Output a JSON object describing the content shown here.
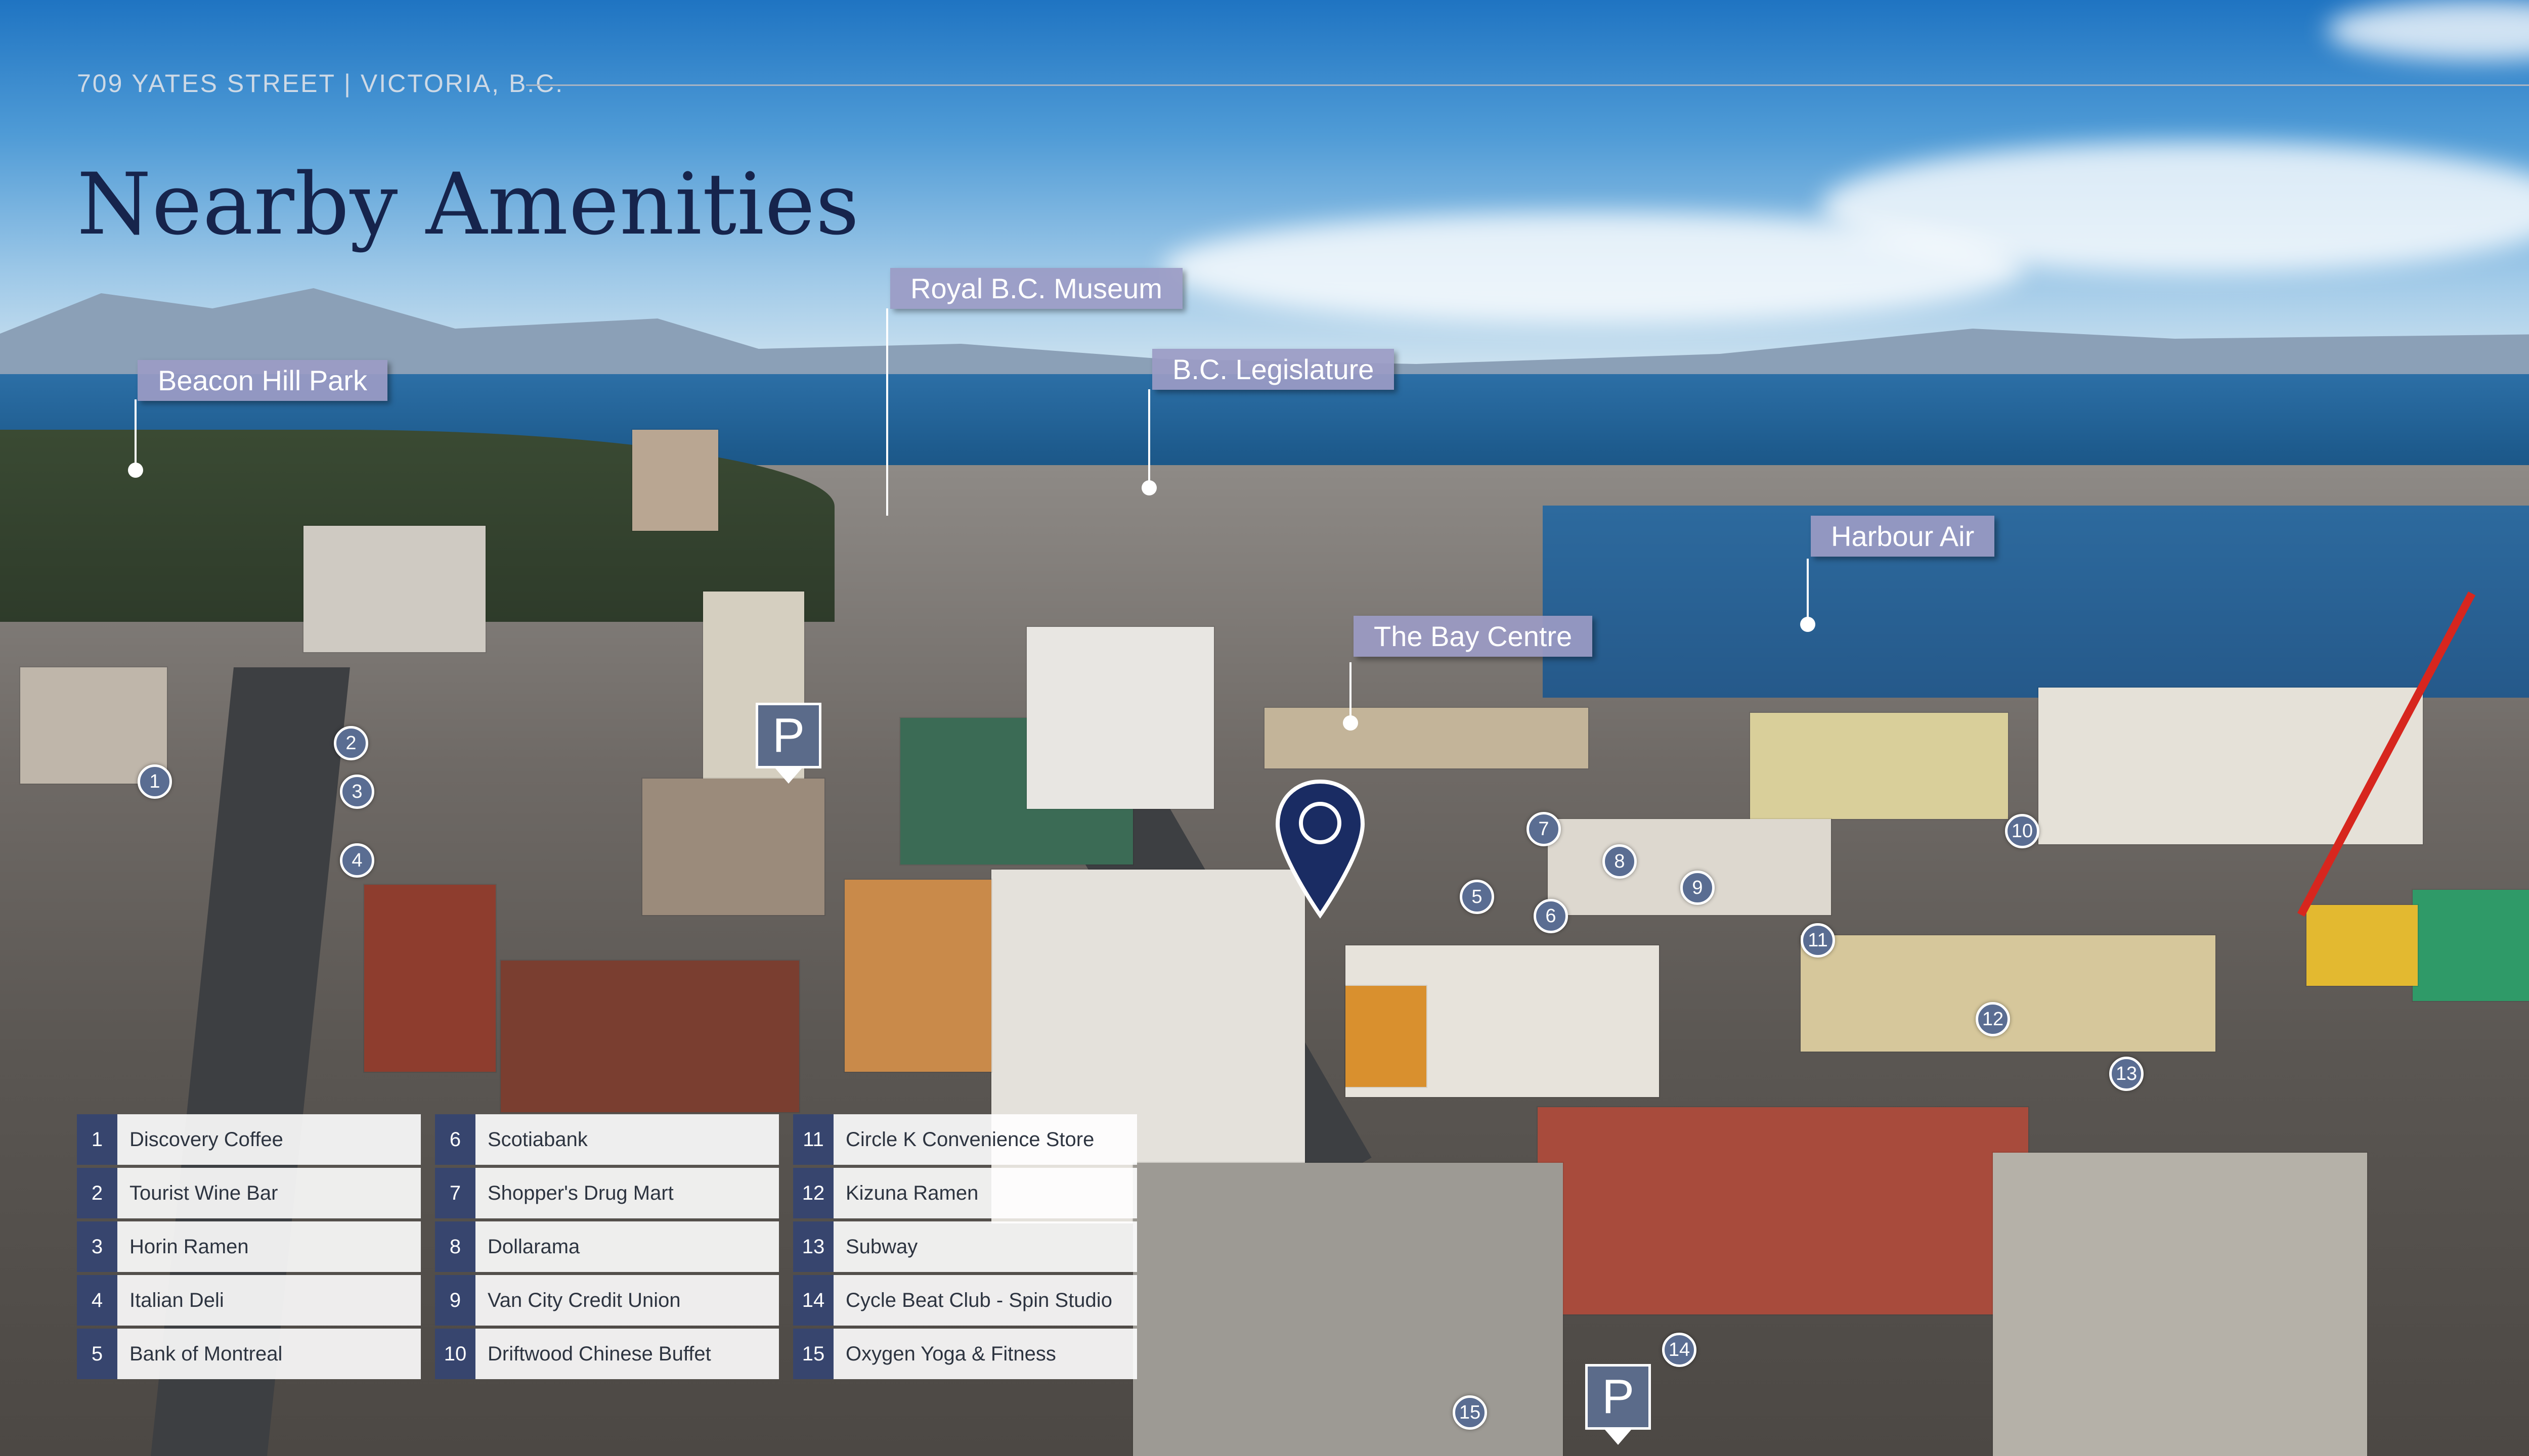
{
  "header": {
    "address": "709 YATES STREET | VICTORIA, B.C."
  },
  "title": "Nearby Amenities",
  "landmarks": [
    {
      "id": "beacon-hill-park",
      "label": "Beacon Hill Park"
    },
    {
      "id": "royal-bc-museum",
      "label": "Royal B.C. Museum"
    },
    {
      "id": "bc-legislature",
      "label": "B.C. Legislature"
    },
    {
      "id": "harbour-air",
      "label": "Harbour Air"
    },
    {
      "id": "bay-centre",
      "label": "The Bay Centre"
    }
  ],
  "map_markers": [
    "1",
    "2",
    "3",
    "4",
    "5",
    "6",
    "7",
    "8",
    "9",
    "10",
    "11",
    "12",
    "13",
    "14",
    "15"
  ],
  "parking_label": "P",
  "amenities": [
    {
      "num": "1",
      "name": "Discovery Coffee"
    },
    {
      "num": "2",
      "name": "Tourist Wine Bar"
    },
    {
      "num": "3",
      "name": "Horin Ramen"
    },
    {
      "num": "4",
      "name": "Italian Deli"
    },
    {
      "num": "5",
      "name": "Bank of Montreal"
    },
    {
      "num": "6",
      "name": "Scotiabank"
    },
    {
      "num": "7",
      "name": "Shopper's Drug Mart"
    },
    {
      "num": "8",
      "name": "Dollarama"
    },
    {
      "num": "9",
      "name": "Van City Credit Union"
    },
    {
      "num": "10",
      "name": "Driftwood Chinese Buffet"
    },
    {
      "num": "11",
      "name": "Circle K Convenience Store"
    },
    {
      "num": "12",
      "name": "Kizuna Ramen"
    },
    {
      "num": "13",
      "name": "Subway"
    },
    {
      "num": "14",
      "name": "Cycle Beat Club - Spin Studio"
    },
    {
      "num": "15",
      "name": "Oxygen Yoga & Fitness"
    }
  ],
  "colors": {
    "title": "#16244c",
    "callout": "#9b9bc4",
    "marker": "#5a6d92",
    "legend_number": "#37456e",
    "pin": "#1a2c63"
  }
}
